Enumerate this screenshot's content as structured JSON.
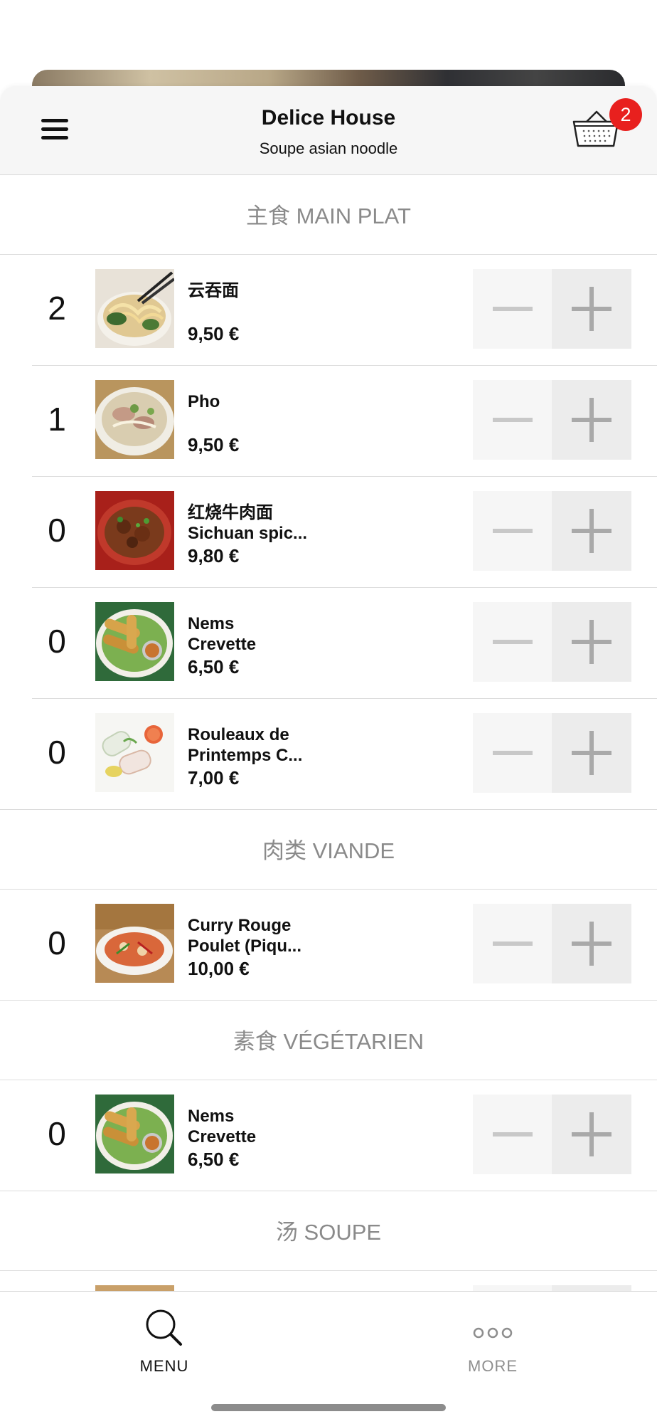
{
  "header": {
    "title": "Delice House",
    "subtitle": "Soupe asian noodle",
    "cart_count": "2"
  },
  "sections": [
    {
      "title": "主食 MAIN PLAT",
      "items": [
        {
          "qty": "2",
          "name": "云吞面",
          "price": "9,50 €",
          "image": "wonton-noodle-photo"
        },
        {
          "qty": "1",
          "name": "Pho",
          "price": "9,50 €",
          "image": "pho-photo"
        },
        {
          "qty": "0",
          "name": "红烧牛肉面\nSichuan spic...",
          "price": "9,80 €",
          "image": "beef-noodle-photo"
        },
        {
          "qty": "0",
          "name": "Nems\nCrevette",
          "price": "6,50 €",
          "image": "spring-rolls-photo"
        },
        {
          "qty": "0",
          "name": "Rouleaux de\nPrintemps C...",
          "price": "7,00 €",
          "image": "fresh-rolls-photo"
        }
      ]
    },
    {
      "title": "肉类 VIANDE",
      "items": [
        {
          "qty": "0",
          "name": "Curry Rouge\nPoulet (Piqu...",
          "price": "10,00 €",
          "image": "red-curry-photo"
        }
      ]
    },
    {
      "title": "素食 VÉGÉTARIEN",
      "items": [
        {
          "qty": "0",
          "name": "Nems\nCrevette",
          "price": "6,50 €",
          "image": "spring-rolls-photo"
        }
      ]
    },
    {
      "title": "汤 SOUPE",
      "items": []
    }
  ],
  "tabbar": {
    "menu_label": "MENU",
    "more_label": "MORE"
  },
  "colors": {
    "badge": "#e8201e",
    "section_text": "#8a8a8a",
    "stepper_minus_bg": "#f6f6f6",
    "stepper_plus_bg": "#ececec"
  },
  "icons": {
    "menu": "hamburger-icon",
    "cart": "basket-icon",
    "search": "search-icon",
    "more": "more-dots-icon"
  }
}
